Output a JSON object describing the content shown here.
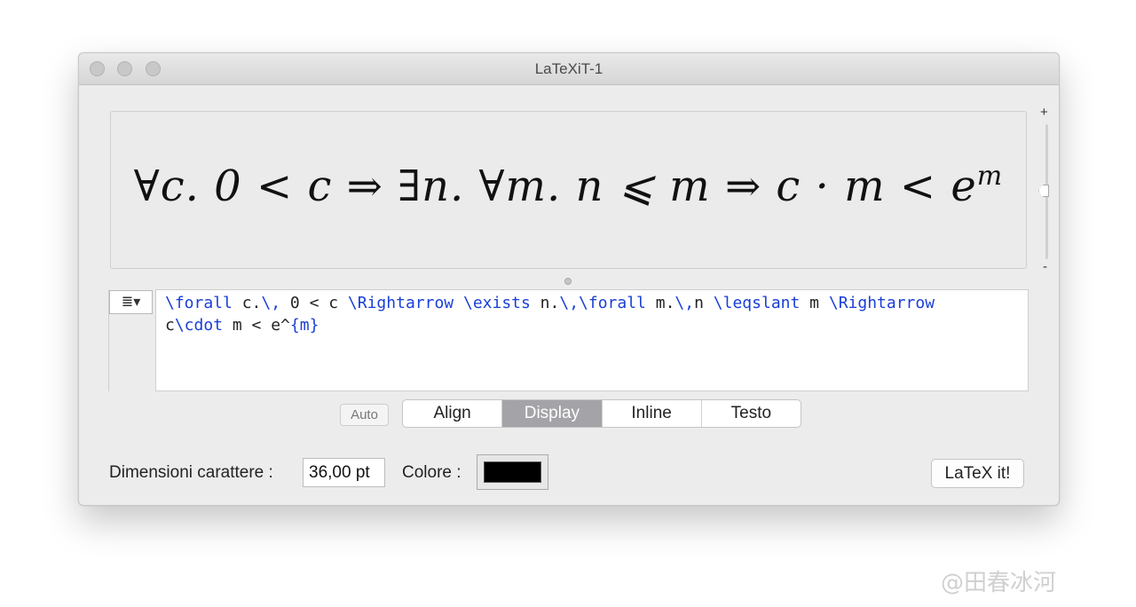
{
  "window": {
    "title": "LaTeXiT-1"
  },
  "preview": {
    "formula_main": "∀c. 0 < c ⇒ ∃n. ∀m. n ⩽ m ⇒ c · m < e",
    "formula_sup": "m"
  },
  "zoom": {
    "plus": "+",
    "minus": "-"
  },
  "editor": {
    "menu_icon": "≣▾",
    "line1": [
      {
        "t": "\\forall",
        "c": true
      },
      {
        "t": " c.",
        "c": false
      },
      {
        "t": "\\,",
        "c": true
      },
      {
        "t": " 0 < c ",
        "c": false
      },
      {
        "t": "\\Rightarrow",
        "c": true
      },
      {
        "t": " ",
        "c": false
      },
      {
        "t": "\\exists",
        "c": true
      },
      {
        "t": " n.",
        "c": false
      },
      {
        "t": "\\,\\forall",
        "c": true
      },
      {
        "t": " m.",
        "c": false
      },
      {
        "t": "\\,",
        "c": true
      },
      {
        "t": "n ",
        "c": false
      },
      {
        "t": "\\leqslant",
        "c": true
      },
      {
        "t": " m ",
        "c": false
      },
      {
        "t": "\\Rightarrow",
        "c": true
      }
    ],
    "line2": [
      {
        "t": "c",
        "c": false
      },
      {
        "t": "\\cdot",
        "c": true
      },
      {
        "t": " m < e^",
        "c": false
      },
      {
        "t": "{m}",
        "c": true
      }
    ]
  },
  "modes": {
    "auto_label": "Auto",
    "options": [
      "Align",
      "Display",
      "Inline",
      "Testo"
    ],
    "selected": "Display"
  },
  "footer": {
    "size_label": "Dimensioni carattere :",
    "size_value": "36,00 pt",
    "color_label": "Colore :",
    "color_value": "#000000",
    "latex_button": "LaTeX it!"
  },
  "watermark": "@田春冰河"
}
